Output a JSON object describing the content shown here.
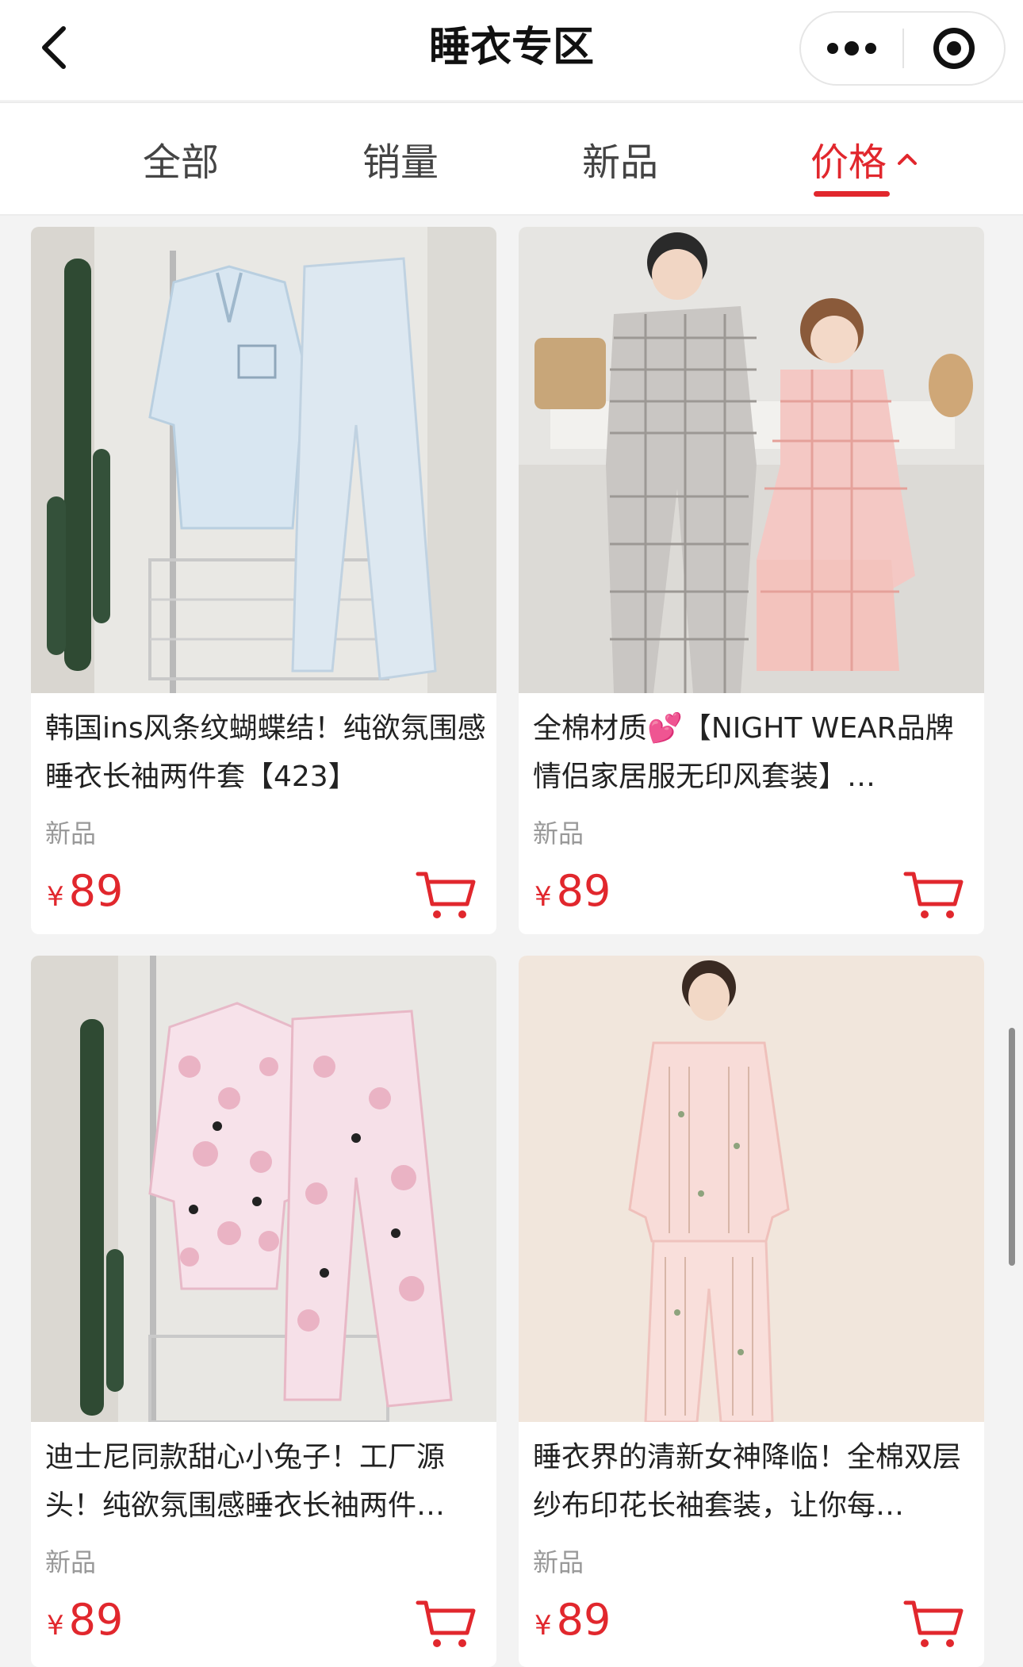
{
  "header": {
    "title": "睡衣专区"
  },
  "icons": {
    "back": "chevron-left-icon",
    "more": "more-dots-icon",
    "close": "target-close-icon",
    "cart": "shopping-cart-icon"
  },
  "tabs": [
    {
      "label": "全部",
      "active": false
    },
    {
      "label": "销量",
      "active": false
    },
    {
      "label": "新品",
      "active": false
    },
    {
      "label": "价格",
      "active": true,
      "sort": "ascending"
    }
  ],
  "products": [
    {
      "title": "韩国ins风条纹蝴蝶结！纯欲氛围感睡衣长袖两件套【423】",
      "tag": "新品",
      "currency": "¥",
      "price": "89"
    },
    {
      "title": "全棉材质💕【NIGHT WEAR品牌情侣家居服无印风套装】…",
      "tag": "新品",
      "currency": "¥",
      "price": "89"
    },
    {
      "title": "迪士尼同款甜心小兔子！工厂源头！纯欲氛围感睡衣长袖两件…",
      "tag": "新品",
      "currency": "¥",
      "price": "89"
    },
    {
      "title": "睡衣界的清新女神降临！全棉双层纱布印花长袖套装，让你每…",
      "tag": "新品",
      "currency": "¥",
      "price": "89"
    }
  ],
  "colors": {
    "accent": "#e1272d",
    "page_bg": "#f3f3f3"
  }
}
